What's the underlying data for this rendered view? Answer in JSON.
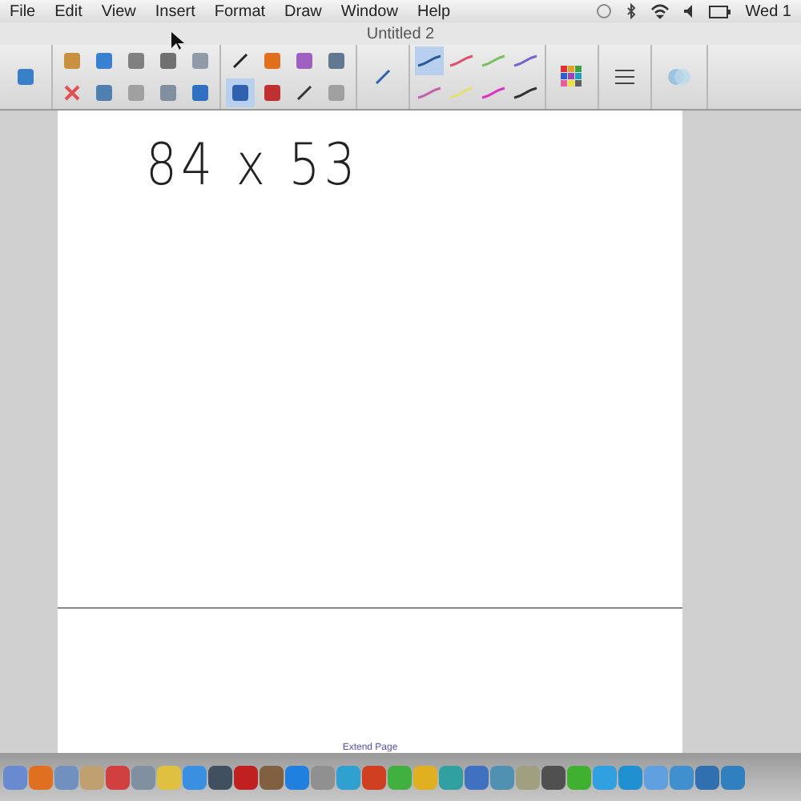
{
  "menu_bar": {
    "items": [
      "File",
      "Edit",
      "View",
      "Insert",
      "Format",
      "Draw",
      "Window",
      "Help"
    ],
    "clock": "Wed 1"
  },
  "window": {
    "title": "Untitled 2"
  },
  "pens": [
    {
      "color": "#2a5a9a",
      "selected": true
    },
    {
      "color": "#e0506a",
      "selected": false
    },
    {
      "color": "#7ac060",
      "selected": false
    },
    {
      "color": "#7a60d0",
      "selected": false
    },
    {
      "color": "#c060b0",
      "selected": false
    },
    {
      "color": "#e8e070",
      "selected": false
    },
    {
      "color": "#e030c0",
      "selected": false
    },
    {
      "color": "#303030",
      "selected": false
    }
  ],
  "page": {
    "ink_text": "84 x 53",
    "extend_link": "Extend Page"
  },
  "dock": {
    "apps": [
      {
        "color": "#6a8ad0"
      },
      {
        "color": "#e07020"
      },
      {
        "color": "#7090c0"
      },
      {
        "color": "#c0a070"
      },
      {
        "color": "#d04040"
      },
      {
        "color": "#8090a0"
      },
      {
        "color": "#e0c040"
      },
      {
        "color": "#3a90e0"
      },
      {
        "color": "#405060"
      },
      {
        "color": "#c02020"
      },
      {
        "color": "#806040"
      },
      {
        "color": "#2080e0"
      },
      {
        "color": "#909090"
      },
      {
        "color": "#30a0d0"
      },
      {
        "color": "#d04020"
      },
      {
        "color": "#40b040"
      },
      {
        "color": "#e0b020"
      },
      {
        "color": "#30a0a0"
      },
      {
        "color": "#4070c0"
      },
      {
        "color": "#5090b0"
      },
      {
        "color": "#a0a080"
      },
      {
        "color": "#505050"
      },
      {
        "color": "#40b030"
      },
      {
        "color": "#30a0e0"
      },
      {
        "color": "#2090d0"
      },
      {
        "color": "#60a0e0"
      },
      {
        "color": "#4090d0"
      },
      {
        "color": "#3070b0"
      },
      {
        "color": "#3080c0"
      }
    ]
  }
}
